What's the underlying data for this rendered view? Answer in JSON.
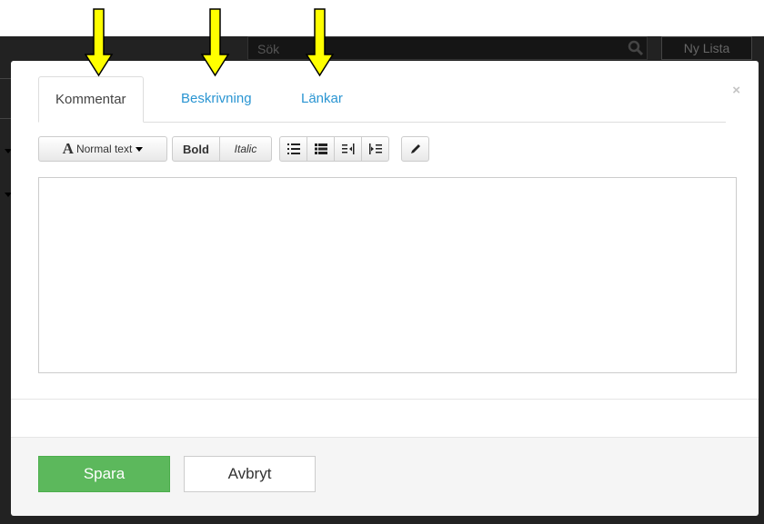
{
  "navbar": {
    "search_placeholder": "Sök",
    "new_list_label": "Ny Lista"
  },
  "modal": {
    "close_label": "×",
    "tabs": [
      {
        "label": "Kommentar",
        "active": true
      },
      {
        "label": "Beskrivning",
        "active": false
      },
      {
        "label": "Länkar",
        "active": false
      }
    ],
    "toolbar": {
      "format_icon": "A",
      "format_label": "Normal text",
      "bold_label": "Bold",
      "italic_label": "Italic",
      "icons": [
        "unordered-list-icon",
        "ordered-list-icon",
        "outdent-icon",
        "indent-icon",
        "pencil-icon"
      ]
    },
    "editor_value": "",
    "save_label": "Spara",
    "cancel_label": "Avbryt"
  },
  "colors": {
    "tab_link": "#2a95d2",
    "save_button": "#5cb85c",
    "arrow": "#ffff00",
    "app_background": "#222222"
  }
}
